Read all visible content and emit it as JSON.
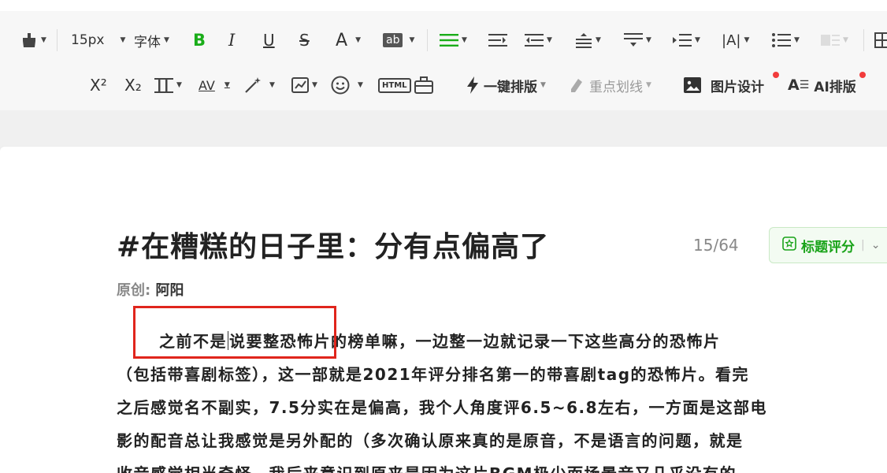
{
  "toolbar": {
    "font_size": "15px",
    "font_family_label": "字体",
    "bold_label": "B",
    "italic_label": "I",
    "underline_label": "U",
    "strike_label": "S",
    "font_color_label": "A",
    "bg_color_label": "ab",
    "superscript_label": "X²",
    "subscript_label": "X₂",
    "letter_spacing_label": "AV",
    "html_label": "HTML",
    "one_click_layout": "一键排版",
    "highlight_underline": "重点划线",
    "image_design": "图片设计",
    "ai_layout": "AI排版",
    "accent_color": "#1aad19",
    "notify_color": "#f23c3c"
  },
  "article": {
    "title": "#在糟糕的日子里：分有点偏高了",
    "title_counter": "15/64",
    "score_button": "标题评分",
    "byline_label": "原创:",
    "author": "阿阳",
    "line1_before_cursor": "之前不是",
    "line1_after_cursor": "说要整恐怖片的榜单嘛，一边整一边就记录一下这些高分的恐怖片",
    "line2": "（包括带喜剧标签），这一部就是2021年评分排名第一的带喜剧tag的恐怖片。看完",
    "line3": "之后感觉名不副实，7.5分实在是偏高，我个人角度评6.5~6.8左右，一方面是这部电",
    "line4": "影的配音总让我感觉是另外配的（多次确认原来真的是原音，不是语言的问题，就是",
    "line5": "收音感觉相当奇怪，我后来意识到原来是因为这片BGM极少而场景音又几乎没有的"
  }
}
